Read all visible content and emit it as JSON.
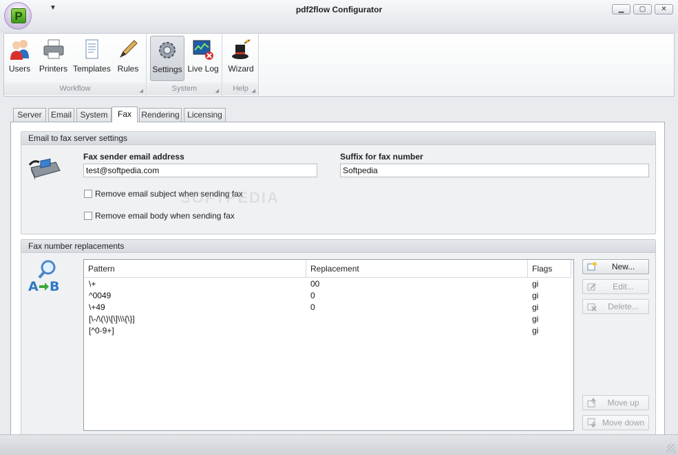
{
  "window": {
    "title": "pdf2flow Configurator",
    "logo_letter": "P",
    "minimize": "▁",
    "maximize": "▢",
    "close": "✕"
  },
  "ribbon": {
    "groups": [
      {
        "caption": "Workflow",
        "buttons": [
          {
            "label": "Users",
            "icon": "users-icon"
          },
          {
            "label": "Printers",
            "icon": "printer-icon"
          },
          {
            "label": "Templates",
            "icon": "templates-icon"
          },
          {
            "label": "Rules",
            "icon": "rules-icon"
          }
        ]
      },
      {
        "caption": "System",
        "buttons": [
          {
            "label": "Settings",
            "icon": "settings-gear-icon",
            "active": true
          },
          {
            "label": "Live Log",
            "icon": "live-log-icon"
          }
        ]
      },
      {
        "caption": "Help",
        "buttons": [
          {
            "label": "Wizard",
            "icon": "wizard-hat-icon"
          }
        ]
      }
    ]
  },
  "tabs": [
    "Server",
    "Email",
    "System",
    "Fax",
    "Rendering",
    "Licensing"
  ],
  "active_tab": "Fax",
  "email_fax": {
    "header": "Email to fax server settings",
    "sender_label": "Fax sender email address",
    "sender_value": "test@softpedia.com",
    "suffix_label": "Suffix for fax number",
    "suffix_value": "Softpedia",
    "remove_subject": "Remove email subject when sending fax",
    "remove_body": "Remove email body when sending fax",
    "remove_subject_checked": false,
    "remove_body_checked": false
  },
  "replacements": {
    "header": "Fax number replacements",
    "columns": [
      "Pattern",
      "Replacement",
      "Flags"
    ],
    "rows": [
      {
        "pattern": "\\+",
        "replacement": "00",
        "flags": "gi"
      },
      {
        "pattern": "^0049",
        "replacement": "0",
        "flags": "gi"
      },
      {
        "pattern": "\\+49",
        "replacement": "0",
        "flags": "gi"
      },
      {
        "pattern": "[\\-/\\(\\)\\[\\]\\\\\\{\\}]",
        "replacement": "",
        "flags": "gi"
      },
      {
        "pattern": "[^0-9+]",
        "replacement": "",
        "flags": "gi"
      }
    ],
    "buttons": {
      "new": "New...",
      "edit": "Edit...",
      "delete": "Delete...",
      "move_up": "Move up",
      "move_down": "Move down"
    }
  },
  "watermark": "SOFTPEDIA"
}
